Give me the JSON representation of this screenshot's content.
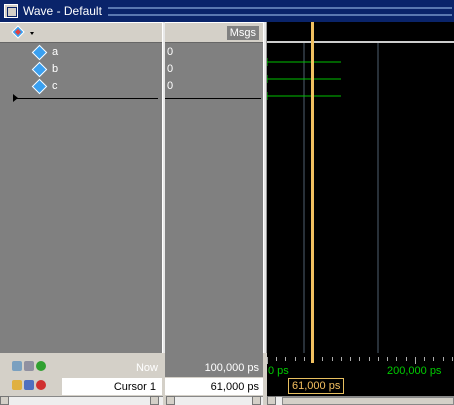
{
  "window": {
    "title": "Wave - Default"
  },
  "names_header": {
    "label": ""
  },
  "values_header": {
    "label": "Msgs"
  },
  "signals": [
    {
      "name": "a",
      "value": "0"
    },
    {
      "name": "b",
      "value": "0"
    },
    {
      "name": "c",
      "value": "0"
    }
  ],
  "footer": {
    "now_label": "Now",
    "now_value": "100,000 ps",
    "cursor_label": "Cursor 1",
    "cursor_value": "61,000 ps"
  },
  "timeline": {
    "start_label": "0 ps",
    "mid_label": "200,000 ps",
    "cursor_readout": "61,000 ps"
  },
  "colors": {
    "signal_trace": "#00c000",
    "cursor": "#f0c060",
    "grid": "#506070",
    "wave_background": "#000000",
    "pane_background": "#808080"
  }
}
